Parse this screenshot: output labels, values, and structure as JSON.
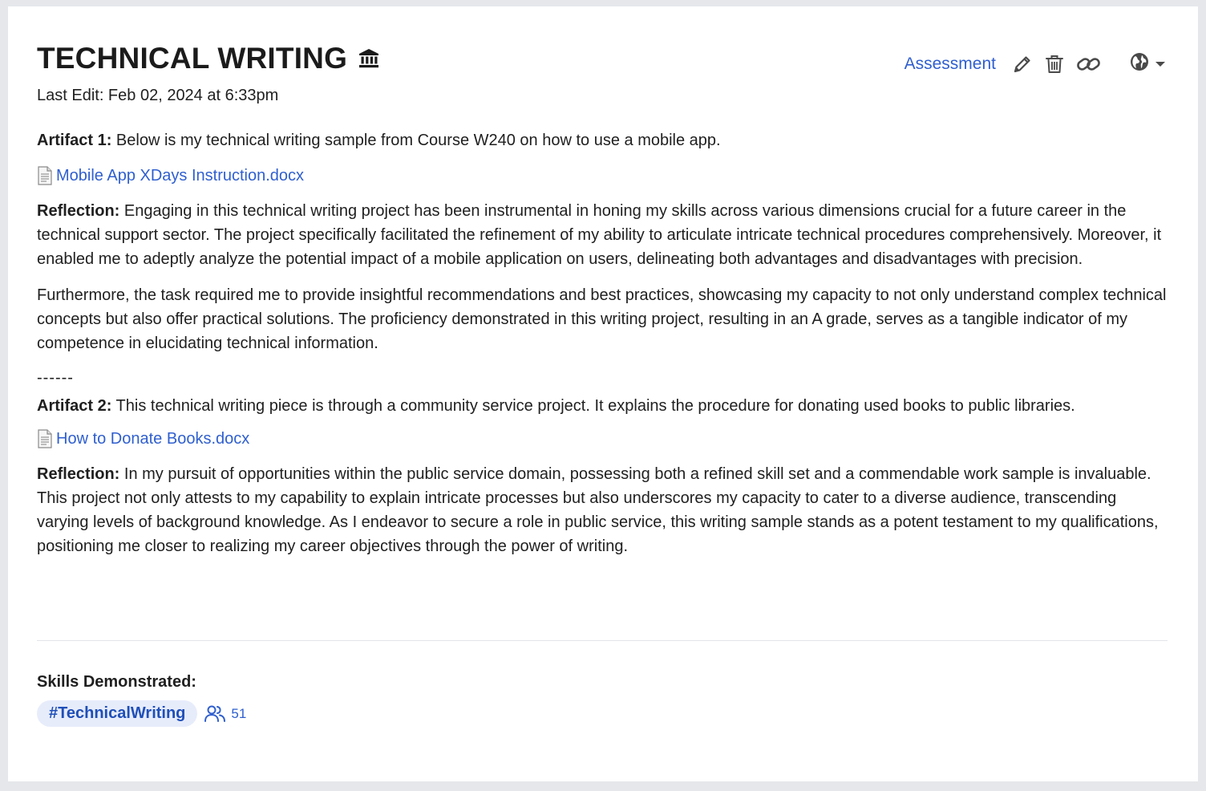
{
  "header": {
    "title": "TECHNICAL WRITING",
    "last_edit": "Last Edit: Feb 02, 2024 at 6:33pm"
  },
  "actions": {
    "assessment_label": "Assessment",
    "icons": [
      "pencil-icon",
      "trash-icon",
      "link-icon",
      "globe-icon",
      "caret-down-icon"
    ]
  },
  "content": {
    "artifact1_label": "Artifact 1:",
    "artifact1_text": " Below is my technical writing sample from Course W240 on how to use a mobile app.",
    "file1": "Mobile App XDays Instruction.docx",
    "reflection1_label": "Reflection:",
    "reflection1_text": " Engaging in this technical writing project has been instrumental in honing my skills across various dimensions crucial for a future career in the technical support sector. The project specifically facilitated the refinement of my ability to articulate intricate technical procedures comprehensively. Moreover, it enabled me to adeptly analyze the potential impact of a mobile application on users, delineating both advantages and disadvantages with precision.",
    "paragraph2": "Furthermore, the task required me to provide insightful recommendations and best practices, showcasing my capacity to not only understand complex technical concepts but also offer practical solutions. The proficiency demonstrated in this writing project, resulting in an A grade, serves as a tangible indicator of my competence in elucidating technical information.",
    "separator": "------",
    "artifact2_label": "Artifact 2:",
    "artifact2_text": " This technical writing piece is through a community service project. It explains the procedure for donating used books to public libraries.",
    "file2": "How to Donate Books.docx",
    "reflection2_label": "Reflection:",
    "reflection2_text": " In my pursuit of opportunities within the public service domain, possessing both a refined skill set and a commendable work sample is invaluable. This project not only attests to my capability to explain intricate processes but also underscores my capacity to cater to a diverse audience, transcending varying levels of background knowledge. As I endeavor to secure a role in public service, this writing sample stands as a potent testament to my qualifications, positioning me closer to realizing my career objectives through the power of writing."
  },
  "skills": {
    "title": "Skills Demonstrated:",
    "tag": "#TechnicalWriting",
    "endorse_count": "51"
  },
  "colors": {
    "link": "#2f5fcf",
    "chip_bg": "#e7ecfb",
    "page_bg": "#e5e7eb"
  }
}
